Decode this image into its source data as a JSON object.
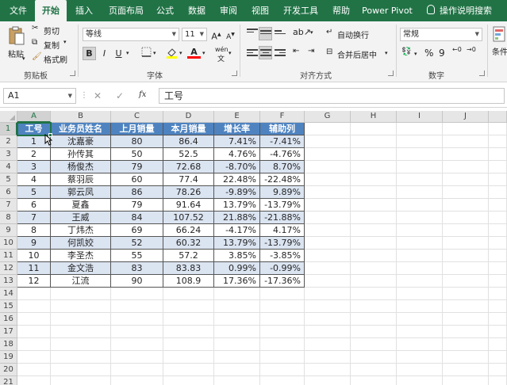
{
  "tabs": [
    {
      "label": "文件",
      "active": false
    },
    {
      "label": "开始",
      "active": true
    },
    {
      "label": "插入",
      "active": false
    },
    {
      "label": "页面布局",
      "active": false
    },
    {
      "label": "公式",
      "active": false
    },
    {
      "label": "数据",
      "active": false
    },
    {
      "label": "审阅",
      "active": false
    },
    {
      "label": "视图",
      "active": false
    },
    {
      "label": "开发工具",
      "active": false
    },
    {
      "label": "帮助",
      "active": false
    },
    {
      "label": "Power Pivot",
      "active": false
    }
  ],
  "tell_me": "操作说明搜索",
  "ribbon": {
    "clipboard": {
      "paste": "粘贴",
      "cut": "剪切",
      "copy": "复制",
      "format_painter": "格式刷",
      "label": "剪贴板"
    },
    "font": {
      "font_name": "等线",
      "font_size": "11",
      "bold": "B",
      "italic": "I",
      "underline": "U",
      "label": "字体",
      "grow": "A",
      "shrink": "A",
      "font_color_letter": "A",
      "phonetic": "wén"
    },
    "alignment": {
      "wrap": "自动换行",
      "merge": "合并后居中",
      "label": "对齐方式"
    },
    "number": {
      "format": "常规",
      "percent": "%",
      "comma": "9",
      "label": "数字",
      "increase_decimal": "←0",
      "decrease_decimal": "→0"
    },
    "styles": {
      "conditional": "条件"
    }
  },
  "formula_bar": {
    "name_box": "A1",
    "fx": "fx",
    "cancel": "✕",
    "enter": "✓",
    "content": "工号"
  },
  "columns": [
    "A",
    "B",
    "C",
    "D",
    "E",
    "F",
    "G",
    "H",
    "I",
    "J"
  ],
  "rows": [
    "1",
    "2",
    "3",
    "4",
    "5",
    "6",
    "7",
    "8",
    "9",
    "10",
    "11",
    "12",
    "13",
    "14",
    "15",
    "16",
    "17",
    "18",
    "19",
    "20",
    "21"
  ],
  "table": {
    "headers": [
      "工号",
      "业务员姓名",
      "上月销量",
      "本月销量",
      "增长率",
      "辅助列"
    ],
    "rows": [
      [
        "1",
        "沈嘉豪",
        "80",
        "86.4",
        "7.41%",
        "-7.41%"
      ],
      [
        "2",
        "孙传其",
        "50",
        "52.5",
        "4.76%",
        "-4.76%"
      ],
      [
        "3",
        "杨俊杰",
        "79",
        "72.68",
        "-8.70%",
        "8.70%"
      ],
      [
        "4",
        "蔡羽辰",
        "60",
        "77.4",
        "22.48%",
        "-22.48%"
      ],
      [
        "5",
        "郭云凤",
        "86",
        "78.26",
        "-9.89%",
        "9.89%"
      ],
      [
        "6",
        "夏鑫",
        "79",
        "91.64",
        "13.79%",
        "-13.79%"
      ],
      [
        "7",
        "王威",
        "84",
        "107.52",
        "21.88%",
        "-21.88%"
      ],
      [
        "8",
        "丁炜杰",
        "69",
        "66.24",
        "-4.17%",
        "4.17%"
      ],
      [
        "9",
        "何凯姣",
        "52",
        "60.32",
        "13.79%",
        "-13.79%"
      ],
      [
        "10",
        "李圣杰",
        "55",
        "57.2",
        "3.85%",
        "-3.85%"
      ],
      [
        "11",
        "金文浩",
        "83",
        "83.83",
        "0.99%",
        "-0.99%"
      ],
      [
        "12",
        "江流",
        "90",
        "108.9",
        "17.36%",
        "-17.36%"
      ]
    ]
  },
  "colors": {
    "brand": "#217346",
    "header_fill": "#4e83c0",
    "band_fill": "#dbe4f1"
  }
}
